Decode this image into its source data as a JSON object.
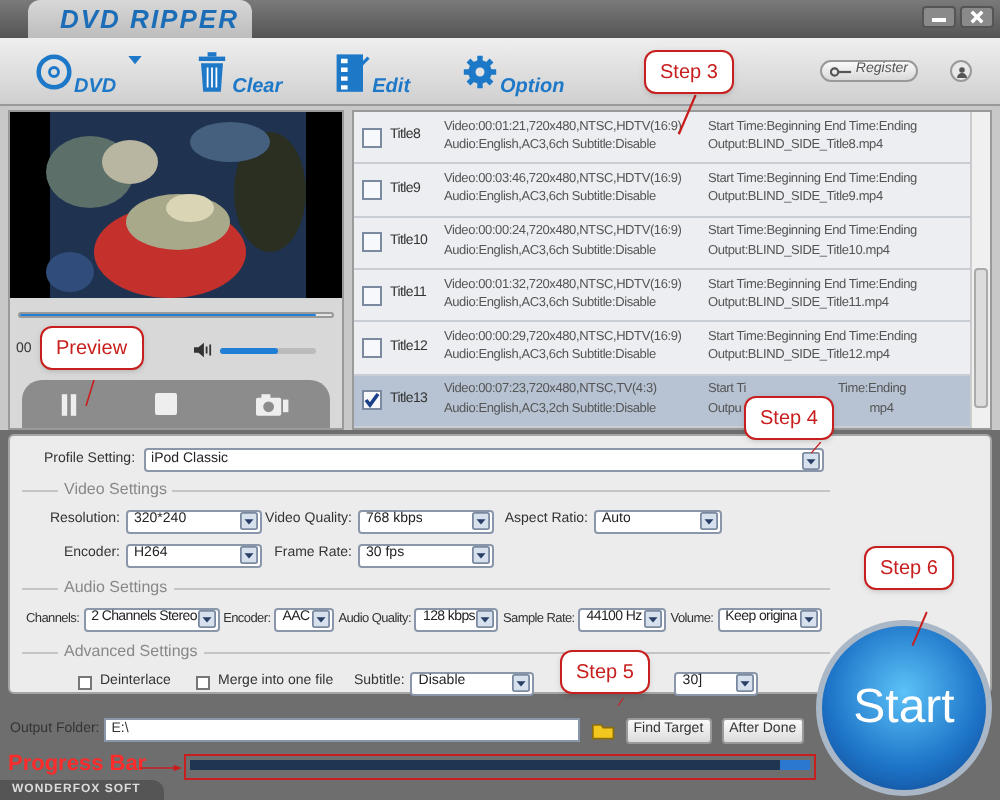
{
  "window": {
    "title": "DVD RIPPER"
  },
  "toolbar": [
    {
      "kind": "dvd",
      "label": "DVD"
    },
    {
      "kind": "clear",
      "label": "Clear"
    },
    {
      "kind": "edit",
      "label": "Edit"
    },
    {
      "kind": "option",
      "label": "Option"
    }
  ],
  "register_button": "Register",
  "preview": {
    "seek_slider": {
      "level": 0.95
    },
    "time": "00",
    "volume_slider": {
      "level": 0.6
    }
  },
  "progress_bar": {
    "level": 0.95
  },
  "titles": [
    {
      "title": "Title8",
      "video": "Video:00:01:21,720x480,NTSC,HDTV(16:9)",
      "audio": "Audio:English,AC3,6ch Subtitle:Disable",
      "start": [
        "Start Time:Beginning End Time:Ending"
      ],
      "output": [
        "Output:BLIND_SIDE_Title8.mp4"
      ],
      "checked": false,
      "selected": false
    },
    {
      "title": "Title9",
      "video": "Video:00:03:46,720x480,NTSC,HDTV(16:9)",
      "audio": "Audio:English,AC3,6ch Subtitle:Disable",
      "start": [
        "Start Time:Beginning End Time:Ending"
      ],
      "output": [
        "Output:BLIND_SIDE_Title9.mp4"
      ],
      "checked": false,
      "selected": false
    },
    {
      "title": "Title10",
      "video": "Video:00:00:24,720x480,NTSC,HDTV(16:9)",
      "audio": "Audio:English,AC3,6ch Subtitle:Disable",
      "start": [
        "Start Time:Beginning End Time:Ending"
      ],
      "output": [
        "Output:BLIND_SIDE_Title10.mp4"
      ],
      "checked": false,
      "selected": false
    },
    {
      "title": "Title11",
      "video": "Video:00:01:32,720x480,NTSC,HDTV(16:9)",
      "audio": "Audio:English,AC3,6ch Subtitle:Disable",
      "start": [
        "Start Time:Beginning End Time:Ending"
      ],
      "output": [
        "Output:BLIND_SIDE_Title11.mp4"
      ],
      "checked": false,
      "selected": false
    },
    {
      "title": "Title12",
      "video": "Video:00:00:29,720x480,NTSC,HDTV(16:9)",
      "audio": "Audio:English,AC3,6ch Subtitle:Disable",
      "start": [
        "Start Time:Beginning End Time:Ending"
      ],
      "output": [
        "Output:BLIND_SIDE_Title12.mp4"
      ],
      "checked": false,
      "selected": false
    },
    {
      "title": "Title13",
      "video": "Video:00:07:23,720x480,NTSC,TV(4:3)",
      "audio": "Audio:English,AC3,2ch Subtitle:Disable",
      "start": [
        "Start Ti",
        "Time:Ending"
      ],
      "output": [
        "Outpu",
        "mp4"
      ],
      "checked": true,
      "selected": true
    }
  ],
  "profile": {
    "label": "Profile Setting:",
    "value": "iPod Classic"
  },
  "video_settings": {
    "title": "Video Settings",
    "rows": [
      [
        {
          "label": "Resolution:",
          "value": "320*240"
        },
        {
          "label": "Video Quality:",
          "value": "768 kbps"
        },
        {
          "label": "Aspect Ratio:",
          "value": "Auto"
        }
      ],
      [
        {
          "label": "Encoder:",
          "value": "H264"
        },
        {
          "label": "Frame Rate:",
          "value": "30 fps"
        }
      ]
    ]
  },
  "audio_settings": {
    "title": "Audio Settings",
    "fields": [
      {
        "label": "Channels:",
        "value": "2 Channels Stereo"
      },
      {
        "label": "Encoder:",
        "value": "AAC"
      },
      {
        "label": "Audio Quality:",
        "value": "128 kbps"
      },
      {
        "label": "Sample Rate:",
        "value": "44100 Hz"
      },
      {
        "label": "Volume:",
        "value": "Keep origina"
      }
    ]
  },
  "advanced_settings": {
    "title": "Advanced Settings",
    "checkboxes": [
      {
        "label": "Deinterlace",
        "checked": false
      },
      {
        "label": "Merge into one file",
        "checked": false
      }
    ],
    "subtitle": {
      "label": "Subtitle:",
      "value": "Disable"
    },
    "dropdown_2": {
      "value": "30]"
    }
  },
  "output_folder": {
    "label": "Output Folder:",
    "value": "E:\\"
  },
  "buttons": [
    "Find Target",
    "After Done"
  ],
  "start_button": "Start",
  "brand": "WONDERFOX SOFT",
  "callouts": [
    "Step 3",
    "Preview",
    "Step 4",
    "Step 6",
    "Step 5"
  ],
  "progress_label": "Progress Bar"
}
